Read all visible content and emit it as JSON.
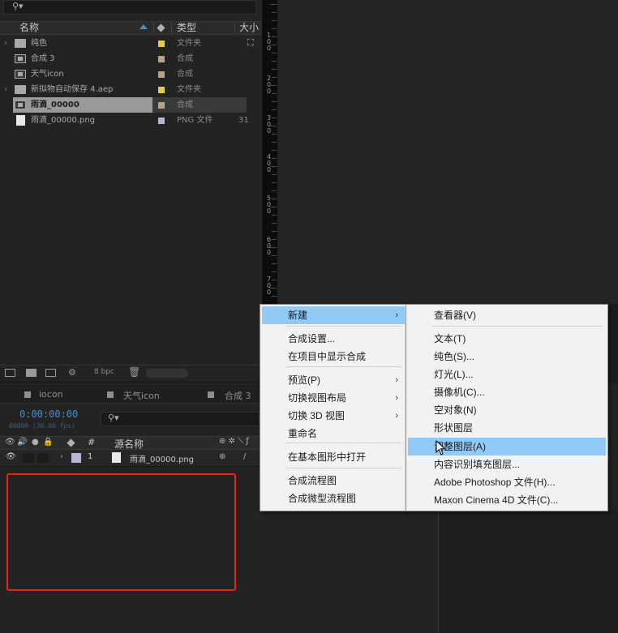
{
  "project_panel": {
    "columns": {
      "name": "名称",
      "type": "类型",
      "size": "大小"
    },
    "items": [
      {
        "name": "纯色",
        "type": "文件夹",
        "size": "",
        "icon": "folder-icon",
        "swatch": "#e1cf47",
        "expand": "›"
      },
      {
        "name": "合成 3",
        "type": "合成",
        "size": "",
        "icon": "composition-icon",
        "swatch": "#b3a48b",
        "expand": ""
      },
      {
        "name": "天气icon",
        "type": "合成",
        "size": "",
        "icon": "composition-icon",
        "swatch": "#b3a48b",
        "expand": ""
      },
      {
        "name": "新拟物自动保存 4.aep",
        "type": "文件夹",
        "size": "",
        "icon": "folder-icon",
        "swatch": "#e1cf47",
        "expand": "›"
      },
      {
        "name": "雨滴_00000",
        "type": "合成",
        "size": "",
        "icon": "composition-icon",
        "swatch": "#b3a48b",
        "expand": ""
      },
      {
        "name": "雨滴_00000.png",
        "type": "PNG 文件",
        "size": "31",
        "icon": "png-file-icon",
        "swatch": "#b9b3d9",
        "expand": ""
      }
    ],
    "footer": {
      "bpc": "8 bpc"
    }
  },
  "ruler": {
    "labels": [
      "100",
      "200",
      "300",
      "400",
      "500",
      "600",
      "700"
    ]
  },
  "timeline": {
    "tabs": [
      "iocon",
      "天气icon",
      "合成 3"
    ],
    "timecode": "0:00:00:00",
    "fps": "00000 (30.00 fps)",
    "columns": {
      "hash": "#",
      "source_name": "源名称"
    },
    "layer": {
      "index": "1",
      "name": "雨滴_00000.png"
    }
  },
  "context_menu": {
    "items": [
      {
        "label": "新建",
        "submenu": true,
        "highlighted": true
      },
      {
        "label": "合成设置...",
        "submenu": false
      },
      {
        "label": "在项目中显示合成",
        "submenu": false
      },
      {
        "label": "预览(P)",
        "submenu": true
      },
      {
        "label": "切换视图布局",
        "submenu": true
      },
      {
        "label": "切换 3D 视图",
        "submenu": true
      },
      {
        "label": "重命名",
        "submenu": false
      },
      {
        "label": "在基本图形中打开",
        "submenu": false
      },
      {
        "label": "合成流程图",
        "submenu": false
      },
      {
        "label": "合成微型流程图",
        "submenu": false
      }
    ]
  },
  "new_submenu": {
    "items": [
      {
        "label": "查看器(V)"
      },
      {
        "label": "文本(T)"
      },
      {
        "label": "纯色(S)..."
      },
      {
        "label": "灯光(L)..."
      },
      {
        "label": "摄像机(C)..."
      },
      {
        "label": "空对象(N)"
      },
      {
        "label": "形状图层"
      },
      {
        "label": "调整图层(A)",
        "highlighted": true
      },
      {
        "label": "内容识别填充图层..."
      },
      {
        "label": "Adobe Photoshop 文件(H)..."
      },
      {
        "label": "Maxon Cinema 4D 文件(C)..."
      }
    ]
  },
  "colors": {
    "highlight": "#91c9f7",
    "timecode": "#3d8fd6",
    "annotation_box": "#e8241c"
  }
}
